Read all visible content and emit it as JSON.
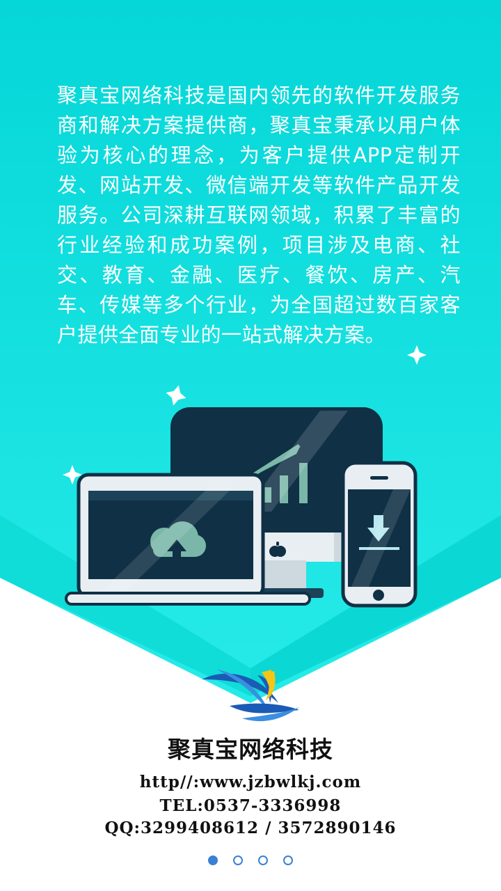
{
  "intro": {
    "text": "聚真宝网络科技是国内领先的软件开发服务商和解决方案提供商，聚真宝秉承以用户体验为核心的理念，为客户提供APP定制开发、网站开发、微信端开发等软件产品开发服务。公司深耕互联网领域，积累了丰富的行业经验和成功案例，项目涉及电商、社交、教育、金融、医疗、餐饮、房产、汽车、传媒等多个行业，为全国超过数百家客户提供全面专业的一站式解决方案。"
  },
  "brand": {
    "name": "聚真宝网络科技"
  },
  "contact": {
    "website": "http//:www.jzbwlkj.com",
    "tel": "TEL:0537-3336998",
    "qq": "QQ:3299408612 / 3572890146"
  },
  "pager": {
    "total": 4,
    "current": 1
  },
  "colors": {
    "background_top": "#05d6d8",
    "background_bottom": "#2ff0ec",
    "accent": "#3b7fd6",
    "logo_yellow": "#f5c518",
    "device_dark": "#0f3045"
  },
  "icons": [
    "cloud-upload-icon",
    "apple-icon",
    "download-icon",
    "bar-chart-icon",
    "sparkle-icon",
    "logo-icon"
  ]
}
